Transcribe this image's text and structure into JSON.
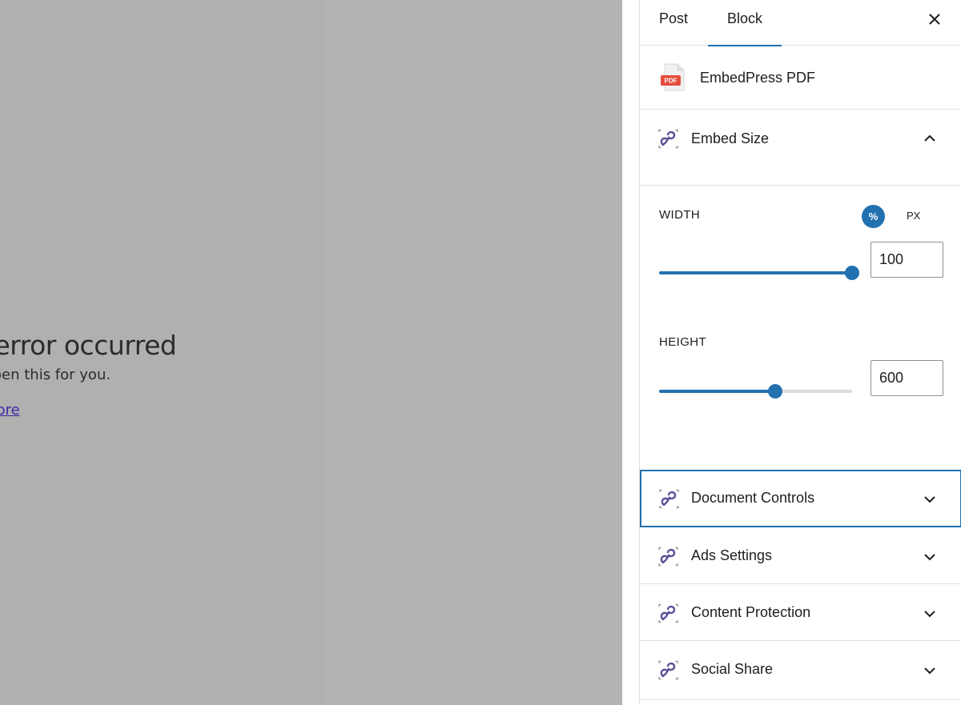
{
  "preview": {
    "error_title": "An error occurred",
    "error_message": "Sorry, we can't open this for you.",
    "error_link": "Learn more"
  },
  "sidebar": {
    "tabs": [
      {
        "label": "Post"
      },
      {
        "label": "Block",
        "active": true
      }
    ],
    "block_name": "EmbedPress PDF",
    "pdf_icon_text": "PDF",
    "panels": {
      "embed_size": {
        "title": "Embed Size",
        "expanded": true,
        "width": {
          "label": "WIDTH",
          "value": "100",
          "slider_fraction": 1.0,
          "units": [
            "%",
            "PX"
          ],
          "selected_unit": "%"
        },
        "height": {
          "label": "HEIGHT",
          "value": "600",
          "slider_fraction": 0.6
        }
      },
      "document_controls": {
        "title": "Document Controls"
      },
      "ads_settings": {
        "title": "Ads Settings"
      },
      "content_protection": {
        "title": "Content Protection"
      },
      "social_share": {
        "title": "Social Share"
      }
    }
  },
  "colors": {
    "accent": "#2271b1",
    "embedpress_icon": "#5b4e96",
    "pdf_red": "#e74c3c",
    "preview_bg": "#b3b4b3"
  }
}
